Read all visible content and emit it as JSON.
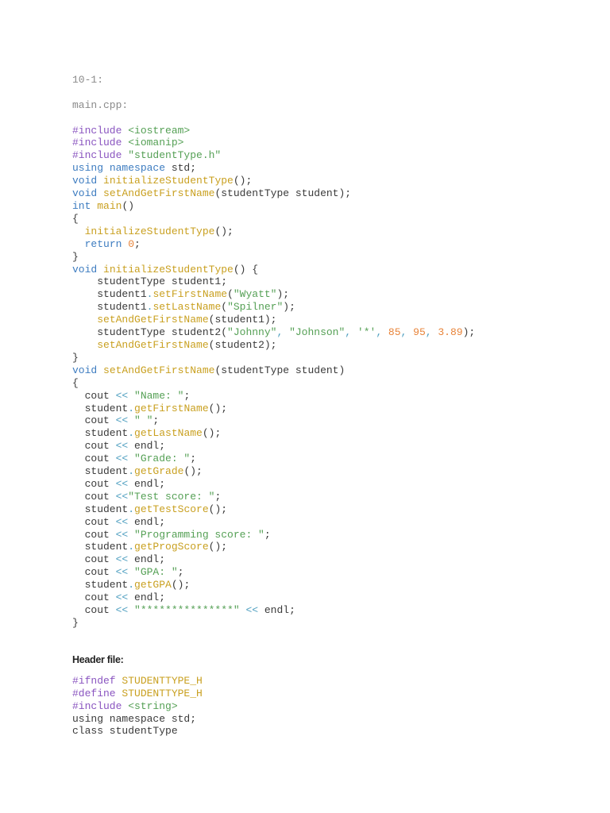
{
  "section_label": "10-1:",
  "file1_label": "main.cpp:",
  "header_label": "Header file:",
  "colors": {
    "p": "#8a55c0",
    "g": "#55a055",
    "b": "#3d7cc0",
    "y": "#c9a020",
    "o": "#e8843a",
    "c": "#4f9fc0",
    "n": "#3a3a3a"
  },
  "main_code": [
    [
      [
        "#include ",
        "p"
      ],
      [
        "<iostream>",
        "g"
      ]
    ],
    [
      [
        "#include ",
        "p"
      ],
      [
        "<iomanip>",
        "g"
      ]
    ],
    [
      [
        "#include ",
        "p"
      ],
      [
        "\"studentType.h\"",
        "g"
      ]
    ],
    [
      [
        "using ",
        "b"
      ],
      [
        "namespace ",
        "b"
      ],
      [
        "std;",
        "n"
      ]
    ],
    [
      [
        "void ",
        "b"
      ],
      [
        "initializeStudentType",
        "y"
      ],
      [
        "();",
        "n"
      ]
    ],
    [
      [
        "void ",
        "b"
      ],
      [
        "setAndGetFirstName",
        "y"
      ],
      [
        "(studentType student);",
        "n"
      ]
    ],
    [
      [
        "int ",
        "b"
      ],
      [
        "main",
        "y"
      ],
      [
        "()",
        "n"
      ]
    ],
    [
      [
        "{",
        "n"
      ]
    ],
    [
      [
        "  ",
        "n"
      ],
      [
        "initializeStudentType",
        "y"
      ],
      [
        "();",
        "n"
      ]
    ],
    [
      [
        "  ",
        "n"
      ],
      [
        "return ",
        "b"
      ],
      [
        "0",
        "o"
      ],
      [
        ";",
        "n"
      ]
    ],
    [
      [
        "}",
        "n"
      ]
    ],
    [
      [
        "void ",
        "b"
      ],
      [
        "initializeStudentType",
        "y"
      ],
      [
        "() {",
        "n"
      ]
    ],
    [
      [
        "    studentType student1;",
        "n"
      ]
    ],
    [
      [
        "    student1",
        "n"
      ],
      [
        ".",
        "c"
      ],
      [
        "setFirstName",
        "y"
      ],
      [
        "(",
        "n"
      ],
      [
        "\"Wyatt\"",
        "g"
      ],
      [
        ");",
        "n"
      ]
    ],
    [
      [
        "    student1",
        "n"
      ],
      [
        ".",
        "c"
      ],
      [
        "setLastName",
        "y"
      ],
      [
        "(",
        "n"
      ],
      [
        "\"Spilner\"",
        "g"
      ],
      [
        ");",
        "n"
      ]
    ],
    [
      [
        "    ",
        "n"
      ],
      [
        "setAndGetFirstName",
        "y"
      ],
      [
        "(student1);",
        "n"
      ]
    ],
    [
      [
        "    studentType student2(",
        "n"
      ],
      [
        "\"Johnny\"",
        "g"
      ],
      [
        ", ",
        "c"
      ],
      [
        "\"Johnson\"",
        "g"
      ],
      [
        ", ",
        "c"
      ],
      [
        "'*'",
        "g"
      ],
      [
        ", ",
        "c"
      ],
      [
        "85",
        "o"
      ],
      [
        ", ",
        "c"
      ],
      [
        "95",
        "o"
      ],
      [
        ", ",
        "c"
      ],
      [
        "3.89",
        "o"
      ],
      [
        ");",
        "n"
      ]
    ],
    [
      [
        "    ",
        "n"
      ],
      [
        "setAndGetFirstName",
        "y"
      ],
      [
        "(student2);",
        "n"
      ]
    ],
    [
      [
        "}",
        "n"
      ]
    ],
    [
      [
        "void ",
        "b"
      ],
      [
        "setAndGetFirstName",
        "y"
      ],
      [
        "(studentType student)",
        "n"
      ]
    ],
    [
      [
        "{",
        "n"
      ]
    ],
    [
      [
        "  cout ",
        "n"
      ],
      [
        "<< ",
        "c"
      ],
      [
        "\"Name: \"",
        "g"
      ],
      [
        ";",
        "n"
      ]
    ],
    [
      [
        "  student",
        "n"
      ],
      [
        ".",
        "c"
      ],
      [
        "getFirstName",
        "y"
      ],
      [
        "();",
        "n"
      ]
    ],
    [
      [
        "  cout ",
        "n"
      ],
      [
        "<< ",
        "c"
      ],
      [
        "\" \"",
        "g"
      ],
      [
        ";",
        "n"
      ]
    ],
    [
      [
        "  student",
        "n"
      ],
      [
        ".",
        "c"
      ],
      [
        "getLastName",
        "y"
      ],
      [
        "();",
        "n"
      ]
    ],
    [
      [
        "  cout ",
        "n"
      ],
      [
        "<< ",
        "c"
      ],
      [
        "endl;",
        "n"
      ]
    ],
    [
      [
        "  cout ",
        "n"
      ],
      [
        "<< ",
        "c"
      ],
      [
        "\"Grade: \"",
        "g"
      ],
      [
        ";",
        "n"
      ]
    ],
    [
      [
        "  student",
        "n"
      ],
      [
        ".",
        "c"
      ],
      [
        "getGrade",
        "y"
      ],
      [
        "();",
        "n"
      ]
    ],
    [
      [
        "  cout ",
        "n"
      ],
      [
        "<< ",
        "c"
      ],
      [
        "endl;",
        "n"
      ]
    ],
    [
      [
        "  cout ",
        "n"
      ],
      [
        "<<",
        "c"
      ],
      [
        "\"Test score: \"",
        "g"
      ],
      [
        ";",
        "n"
      ]
    ],
    [
      [
        "  student",
        "n"
      ],
      [
        ".",
        "c"
      ],
      [
        "getTestScore",
        "y"
      ],
      [
        "();",
        "n"
      ]
    ],
    [
      [
        "  cout ",
        "n"
      ],
      [
        "<< ",
        "c"
      ],
      [
        "endl;",
        "n"
      ]
    ],
    [
      [
        "  cout ",
        "n"
      ],
      [
        "<< ",
        "c"
      ],
      [
        "\"Programming score: \"",
        "g"
      ],
      [
        ";",
        "n"
      ]
    ],
    [
      [
        "  student",
        "n"
      ],
      [
        ".",
        "c"
      ],
      [
        "getProgScore",
        "y"
      ],
      [
        "();",
        "n"
      ]
    ],
    [
      [
        "  cout ",
        "n"
      ],
      [
        "<< ",
        "c"
      ],
      [
        "endl;",
        "n"
      ]
    ],
    [
      [
        "  cout ",
        "n"
      ],
      [
        "<< ",
        "c"
      ],
      [
        "\"GPA: \"",
        "g"
      ],
      [
        ";",
        "n"
      ]
    ],
    [
      [
        "  student",
        "n"
      ],
      [
        ".",
        "c"
      ],
      [
        "getGPA",
        "y"
      ],
      [
        "();",
        "n"
      ]
    ],
    [
      [
        "  cout ",
        "n"
      ],
      [
        "<< ",
        "c"
      ],
      [
        "endl;",
        "n"
      ]
    ],
    [
      [
        "  cout ",
        "n"
      ],
      [
        "<< ",
        "c"
      ],
      [
        "\"***************\"",
        "g"
      ],
      [
        " << ",
        "c"
      ],
      [
        "endl;",
        "n"
      ]
    ],
    [
      [
        "}",
        "n"
      ]
    ]
  ],
  "header_code": [
    [
      [
        "#ifndef ",
        "p"
      ],
      [
        "STUDENTTYPE_H",
        "y"
      ]
    ],
    [
      [
        "#define ",
        "p"
      ],
      [
        "STUDENTTYPE_H",
        "y"
      ]
    ],
    [
      [
        "#include ",
        "p"
      ],
      [
        "<string>",
        "g"
      ]
    ],
    [
      [
        "using namespace std;",
        "n"
      ]
    ],
    [
      [
        "class studentType",
        "n"
      ]
    ]
  ]
}
